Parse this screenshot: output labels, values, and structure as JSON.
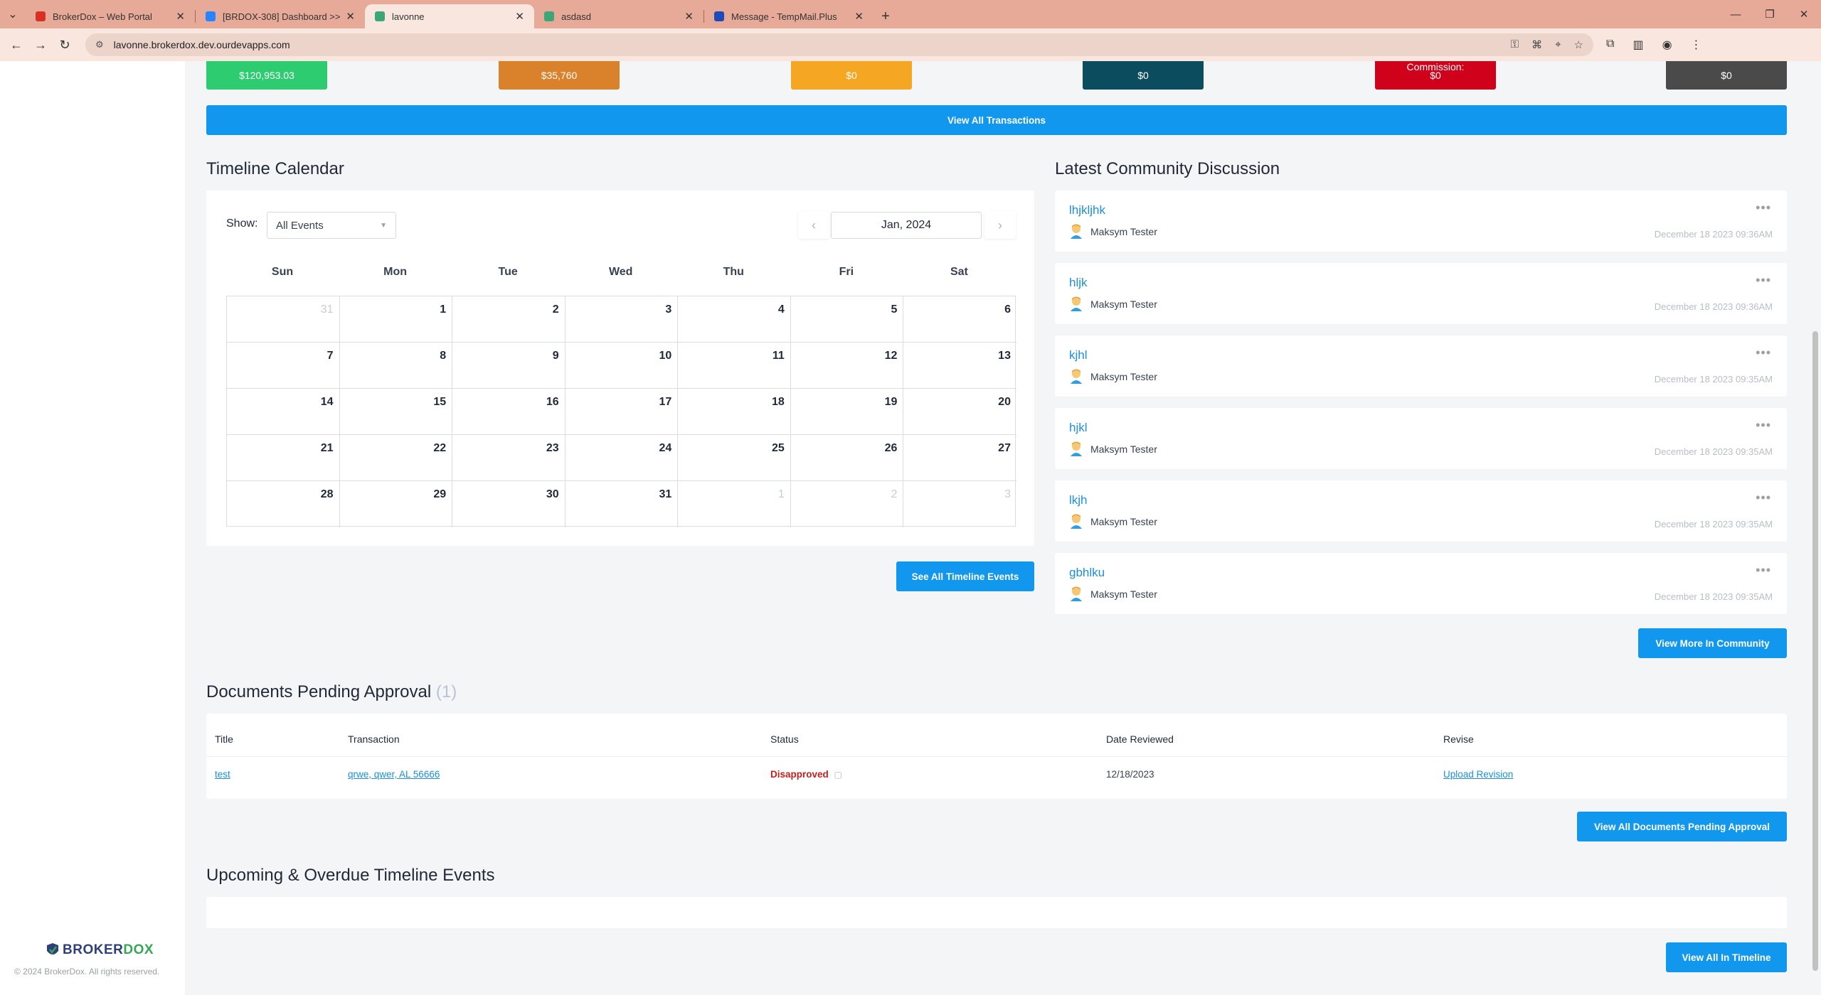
{
  "browser": {
    "tabs": [
      {
        "title": "BrokerDox – Web Portal",
        "color": "#d93025"
      },
      {
        "title": "[BRDOX-308] Dashboard >>> ",
        "color": "#2684ff"
      },
      {
        "title": "lavonne",
        "color": "#3ba776"
      },
      {
        "title": "asdasd",
        "color": "#3ba776"
      },
      {
        "title": "Message - TempMail.Plus",
        "color": "#1e4bb8"
      }
    ],
    "url": "lavonne.brokerdox.dev.ourdevapps.com"
  },
  "stats": [
    {
      "label": "",
      "value": "$120,953.03",
      "color": "#2ecc71"
    },
    {
      "label": "",
      "value": "$35,760",
      "color": "#d9822b"
    },
    {
      "label": "",
      "value": "$0",
      "color": "#f5a623"
    },
    {
      "label": "",
      "value": "$0",
      "color": "#0b4c5f"
    },
    {
      "label": "Commission:",
      "value": "$0",
      "color": "#d0021b"
    },
    {
      "label": "",
      "value": "$0",
      "color": "#4a4a4a"
    }
  ],
  "view_all_transactions": "View All Transactions",
  "calendar": {
    "title": "Timeline Calendar",
    "show_label": "Show:",
    "filter": "All Events",
    "month": "Jan, 2024",
    "weekdays": [
      "Sun",
      "Mon",
      "Tue",
      "Wed",
      "Thu",
      "Fri",
      "Sat"
    ],
    "weeks": [
      [
        {
          "d": "31",
          "m": true
        },
        {
          "d": "1"
        },
        {
          "d": "2"
        },
        {
          "d": "3"
        },
        {
          "d": "4"
        },
        {
          "d": "5"
        },
        {
          "d": "6"
        }
      ],
      [
        {
          "d": "7"
        },
        {
          "d": "8"
        },
        {
          "d": "9"
        },
        {
          "d": "10"
        },
        {
          "d": "11"
        },
        {
          "d": "12"
        },
        {
          "d": "13"
        }
      ],
      [
        {
          "d": "14"
        },
        {
          "d": "15"
        },
        {
          "d": "16"
        },
        {
          "d": "17"
        },
        {
          "d": "18"
        },
        {
          "d": "19"
        },
        {
          "d": "20"
        }
      ],
      [
        {
          "d": "21"
        },
        {
          "d": "22"
        },
        {
          "d": "23"
        },
        {
          "d": "24"
        },
        {
          "d": "25"
        },
        {
          "d": "26"
        },
        {
          "d": "27"
        }
      ],
      [
        {
          "d": "28"
        },
        {
          "d": "29"
        },
        {
          "d": "30"
        },
        {
          "d": "31"
        },
        {
          "d": "1",
          "m": true
        },
        {
          "d": "2",
          "m": true
        },
        {
          "d": "3",
          "m": true
        }
      ]
    ],
    "see_all": "See All Timeline Events"
  },
  "community": {
    "title": "Latest Community Discussion",
    "posts": [
      {
        "title": "lhjkljhk",
        "author": "Maksym Tester",
        "date": "December 18 2023 09:36AM"
      },
      {
        "title": "hljk",
        "author": "Maksym Tester",
        "date": "December 18 2023 09:36AM"
      },
      {
        "title": "kjhl",
        "author": "Maksym Tester",
        "date": "December 18 2023 09:35AM"
      },
      {
        "title": "hjkl",
        "author": "Maksym Tester",
        "date": "December 18 2023 09:35AM"
      },
      {
        "title": "lkjh",
        "author": "Maksym Tester",
        "date": "December 18 2023 09:35AM"
      },
      {
        "title": "gbhlku",
        "author": "Maksym Tester",
        "date": "December 18 2023 09:35AM"
      }
    ],
    "view_more": "View More In Community"
  },
  "documents": {
    "title": "Documents Pending Approval",
    "count": "(1)",
    "columns": [
      "Title",
      "Transaction",
      "Status",
      "Date Reviewed",
      "Revise"
    ],
    "row": {
      "title": "test",
      "transaction": "qrwe, qwer, AL 56666",
      "status": "Disapproved",
      "date": "12/18/2023",
      "revise": "Upload Revision"
    },
    "view_all": "View All Documents Pending Approval"
  },
  "upcoming": {
    "title": "Upcoming & Overdue Timeline Events",
    "view_all": "View All In Timeline"
  },
  "footer": {
    "brand_a": "BROKER",
    "brand_b": "DOX",
    "copyright": "© 2024 BrokerDox. All rights reserved."
  }
}
